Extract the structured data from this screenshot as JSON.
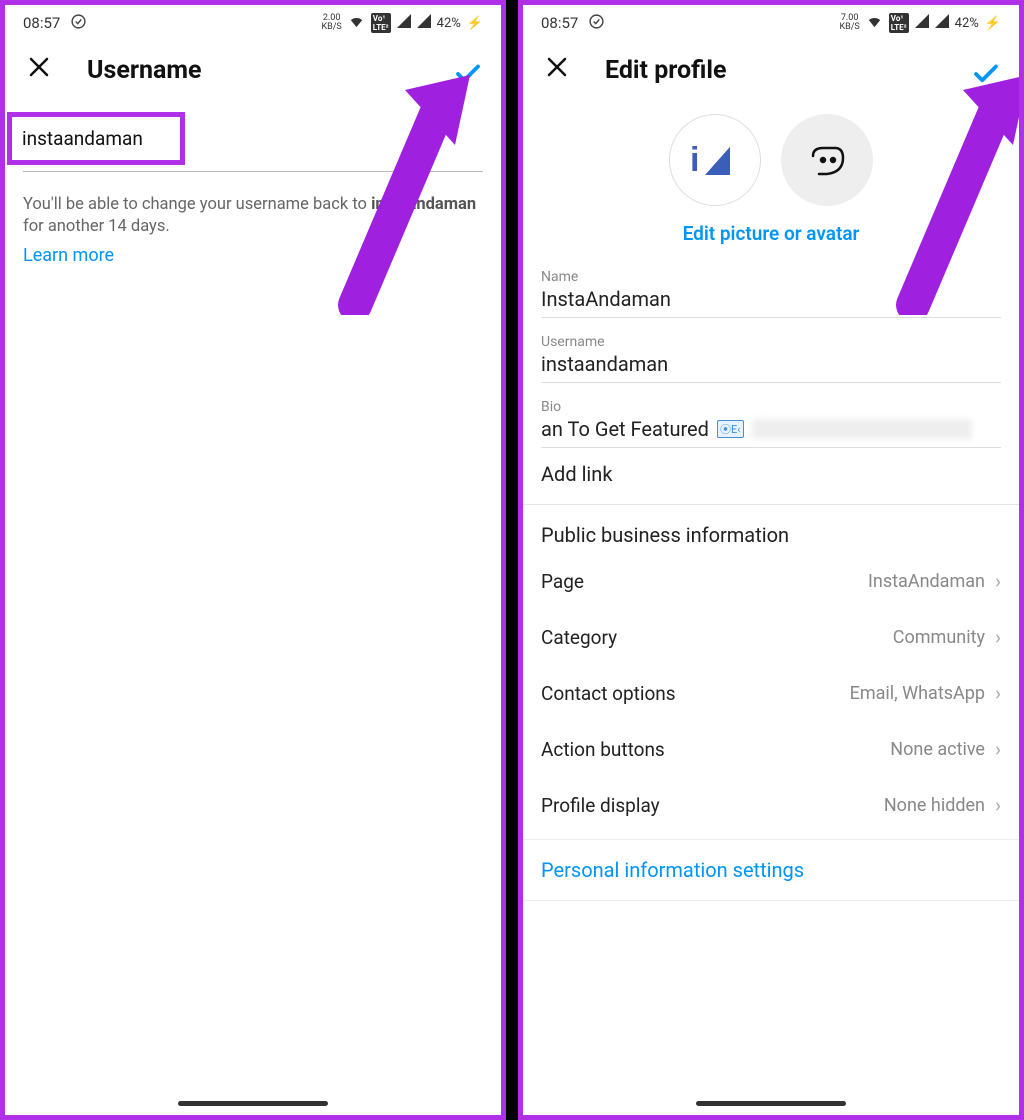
{
  "status": {
    "time": "08:57",
    "net_left": "2.00",
    "net_right": "7.00",
    "net_unit": "KB/S",
    "battery": "42%"
  },
  "left": {
    "title": "Username",
    "input_value": "instaandaman",
    "help_prefix": "You'll be able to change your username back to ",
    "help_bold": "instaandaman",
    "help_suffix": " for another 14 days.",
    "learn_more": "Learn more"
  },
  "right": {
    "title": "Edit profile",
    "edit_picture": "Edit picture or avatar",
    "fields": {
      "name_label": "Name",
      "name_value": "InstaAndaman",
      "username_label": "Username",
      "username_value": "instaandaman",
      "bio_label": "Bio",
      "bio_value": "an To Get Featured"
    },
    "add_link": "Add link",
    "section_title": "Public business information",
    "rows": {
      "page": {
        "label": "Page",
        "value": "InstaAndaman"
      },
      "category": {
        "label": "Category",
        "value": "Community"
      },
      "contact": {
        "label": "Contact options",
        "value": "Email, WhatsApp"
      },
      "actions": {
        "label": "Action buttons",
        "value": "None active"
      },
      "display": {
        "label": "Profile display",
        "value": "None hidden"
      }
    },
    "personal_link": "Personal information settings"
  }
}
